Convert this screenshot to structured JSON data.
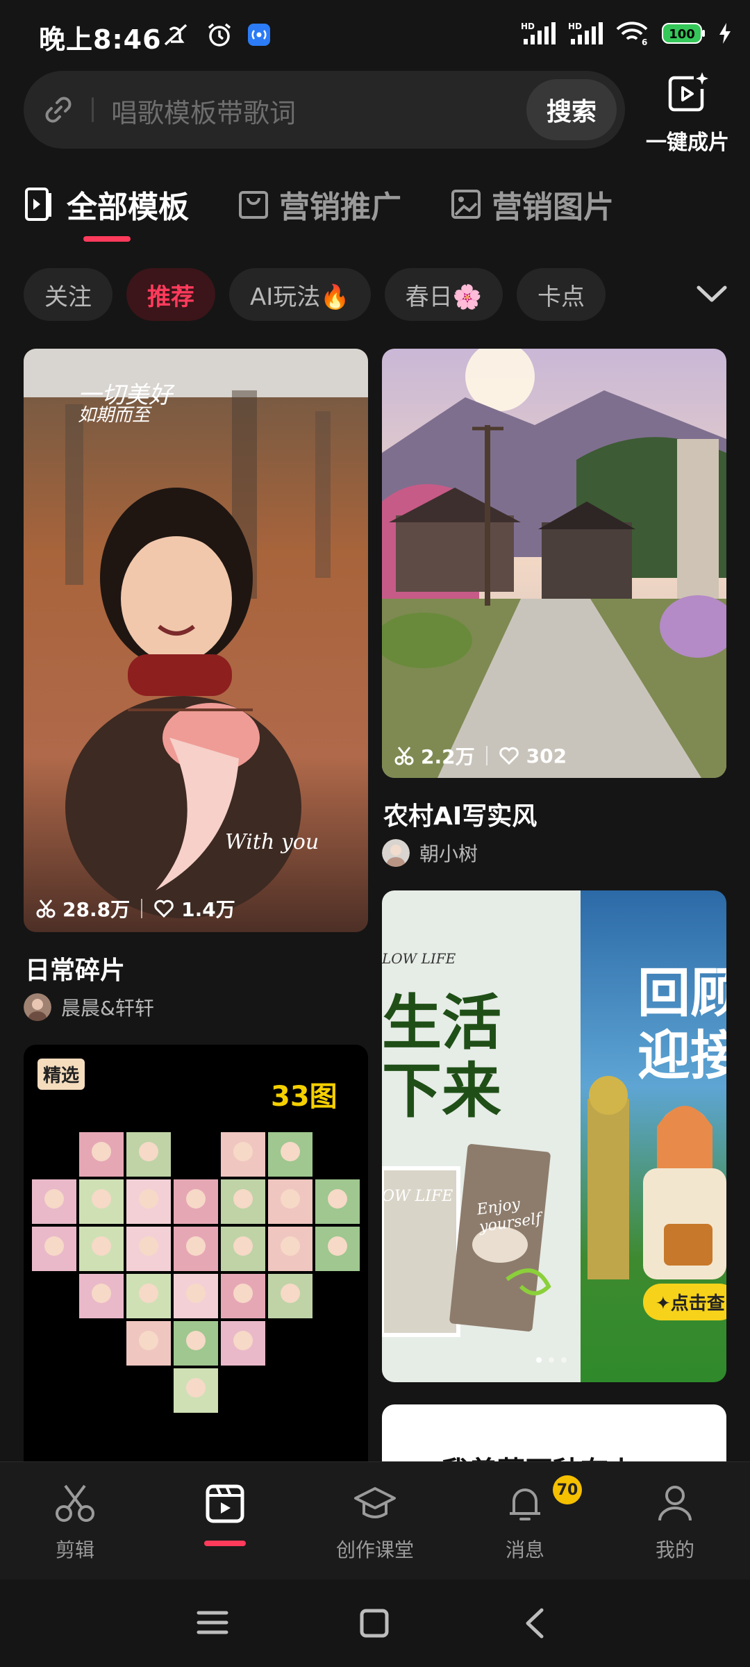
{
  "status_bar": {
    "time": "晚上8:46",
    "battery": "100",
    "signal_1": "HD",
    "signal_2": "HD",
    "wifi_badge": "6"
  },
  "search": {
    "placeholder": "唱歌模板带歌词",
    "button_label": "搜索",
    "one_click_label": "一键成片"
  },
  "tabs": [
    {
      "label": "全部模板",
      "icon": "template-icon",
      "active": true
    },
    {
      "label": "营销推广",
      "icon": "shopping-bag-icon",
      "active": false
    },
    {
      "label": "营销图片",
      "icon": "image-icon",
      "active": false
    }
  ],
  "chips": [
    {
      "label": "关注",
      "active": false
    },
    {
      "label": "推荐",
      "active": true
    },
    {
      "label": "AI玩法🔥",
      "active": false
    },
    {
      "label": "春日🌸",
      "active": false
    },
    {
      "label": "卡点",
      "active": false
    }
  ],
  "cards": {
    "left1": {
      "overlay_text_1": "一切美好",
      "overlay_text_2": "如期而至",
      "overlay_signature": "With you",
      "uses": "28.8万",
      "likes": "1.4万",
      "title": "日常碎片",
      "author": "晨晨&轩轩"
    },
    "right1": {
      "uses": "2.2万",
      "likes": "302",
      "title": "农村AI写实风",
      "author": "朝小树"
    },
    "left2": {
      "badge": "精选",
      "count_text": "33图"
    },
    "right2": {
      "left_tag": "LOW LIFE",
      "left_big_1": "生活",
      "left_big_2": "下来",
      "left_tag_2": "OW LIFE",
      "left_script": "Enjoy yourself",
      "right_big_1": "回顾",
      "right_big_2": "迎接",
      "right_button": "✦点击查"
    },
    "right3": {
      "text": "我着草再种有上："
    }
  },
  "bottom_nav": [
    {
      "label": "剪辑",
      "icon": "scissors-icon"
    },
    {
      "label": "",
      "icon": "template-video-icon",
      "active": true
    },
    {
      "label": "创作课堂",
      "icon": "graduation-cap-icon"
    },
    {
      "label": "消息",
      "icon": "bell-icon",
      "badge": "70"
    },
    {
      "label": "我的",
      "icon": "profile-icon"
    }
  ],
  "colors": {
    "accent": "#ff3b5c",
    "background": "#151515",
    "badge": "#f5c000",
    "battery": "#35c759"
  }
}
